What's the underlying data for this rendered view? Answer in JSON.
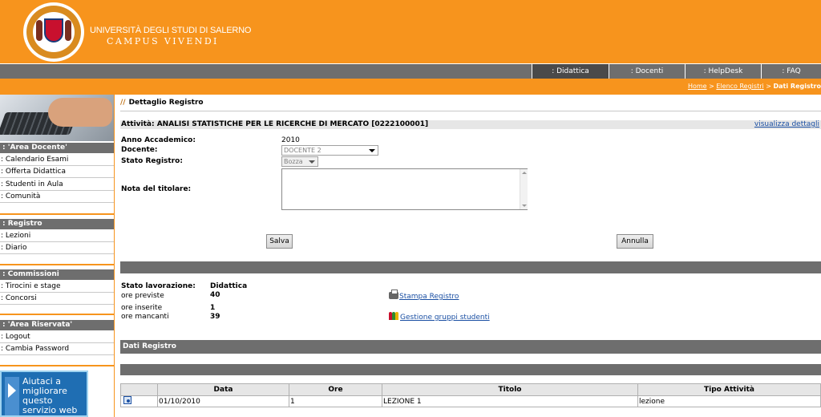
{
  "header": {
    "university_name": "UNIVERSITÀ DEGLI STUDI DI SALERNO",
    "motto": "CAMPUS VIVENDI",
    "logo_icon": "university-seal-logo"
  },
  "nav": {
    "tabs": [
      {
        "label": ": Didattica",
        "active": true
      },
      {
        "label": ": Docenti",
        "active": false
      },
      {
        "label": ": HelpDesk",
        "active": false
      },
      {
        "label": ": FAQ",
        "active": false
      }
    ]
  },
  "breadcrumb": {
    "home": "Home",
    "sep1": " > ",
    "registri": "Elenco Registri",
    "sep2": " > ",
    "current": "Dati Registro"
  },
  "sidebar": {
    "sections": [
      {
        "title": ": 'Area Docente'",
        "items": [
          ": Calendario Esami",
          ": Offerta Didattica",
          ": Studenti in Aula",
          ": Comunità"
        ]
      },
      {
        "title": ": Registro",
        "items": [
          ": Lezioni",
          ": Diario"
        ]
      },
      {
        "title": ": Commissioni",
        "items": [
          ": Tirocini e stage",
          ": Concorsi"
        ]
      },
      {
        "title": ": 'Area Riservata'",
        "items": [
          ": Logout",
          ": Cambia Password"
        ]
      }
    ],
    "help_box": {
      "line1": "Aiutaci a",
      "line2": "migliorare",
      "line3": "questo",
      "line4": "servizio web"
    }
  },
  "main": {
    "page_title_prefix": "//",
    "page_title": "Dettaglio Registro",
    "activity": "Attività: ANALISI STATISTICHE PER LE RICERCHE DI MERCATO [0222100001]",
    "details_link": "visualizza dettagli",
    "form": {
      "anno_label": "Anno Accademico:",
      "anno_value": "2010",
      "docente_label": "Docente:",
      "docente_value": "DOCENTE 2",
      "stato_label": "Stato Registro:",
      "stato_value": "Bozza",
      "nota_label": "Nota del titolare:",
      "nota_value": ""
    },
    "save_label": "Salva",
    "cancel_label": "Annulla",
    "status": {
      "stato_label": "Stato lavorazione:",
      "stato_value": "Didattica",
      "previste_label": "ore previste",
      "previste_value": "40",
      "inserite_label": "ore inserite",
      "inserite_value": "1",
      "mancanti_label": "ore mancanti",
      "mancanti_value": "39"
    },
    "links": {
      "print": "Stampa Registro",
      "groups": "Gestione gruppi studenti"
    },
    "dati_title": "Dati Registro",
    "table": {
      "headers": [
        "",
        "Data",
        "Ore",
        "Titolo",
        "Tipo Attività"
      ],
      "rows": [
        {
          "data": "01/10/2010",
          "ore": "1",
          "titolo": "LEZIONE 1",
          "tipo": "lezione"
        }
      ]
    }
  }
}
